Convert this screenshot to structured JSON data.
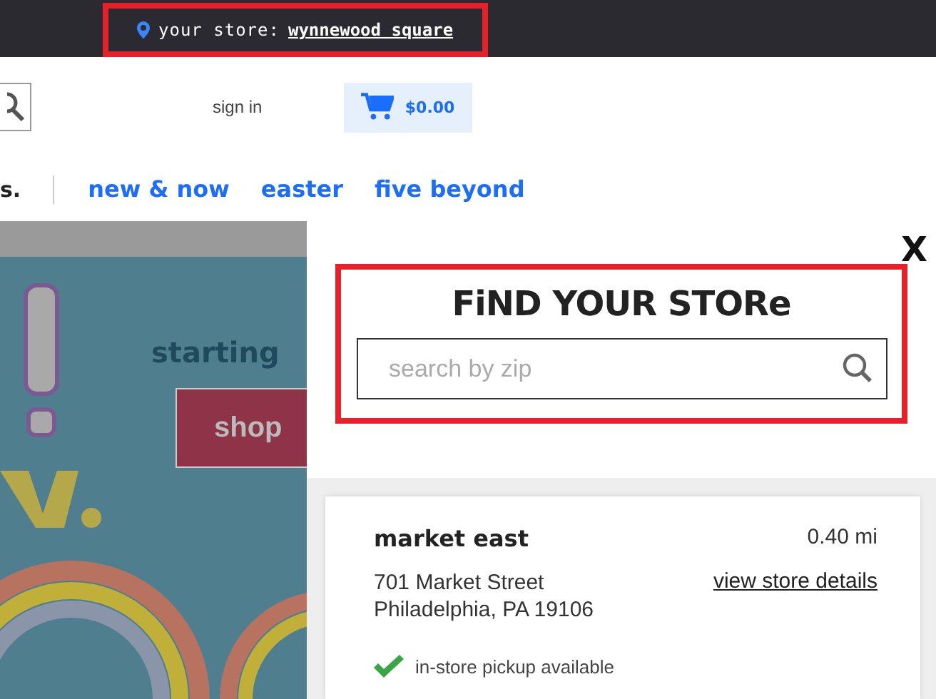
{
  "top_bar": {
    "label": "your store:",
    "store": "wynnewood square"
  },
  "header": {
    "sign_in": "sign in",
    "cart_total": "$0.00"
  },
  "nav": {
    "items": [
      {
        "label": "s.",
        "kind": "plain"
      },
      {
        "label": "new & now",
        "kind": "link"
      },
      {
        "label": "easter",
        "kind": "link"
      },
      {
        "label": "five beyond",
        "kind": "link"
      }
    ]
  },
  "banner": {
    "tagline": "starting",
    "button": "shop"
  },
  "store_panel": {
    "close": "X",
    "title": "FiND YOUR STORe",
    "search": {
      "placeholder": "search by zip"
    },
    "stores": [
      {
        "name": "market east",
        "distance": "0.40 mi",
        "address": [
          "701 Market Street",
          "Philadelphia, PA 19106"
        ],
        "details_link": "view store details",
        "pickup": "in-store pickup available",
        "pickup_available": true
      }
    ]
  }
}
